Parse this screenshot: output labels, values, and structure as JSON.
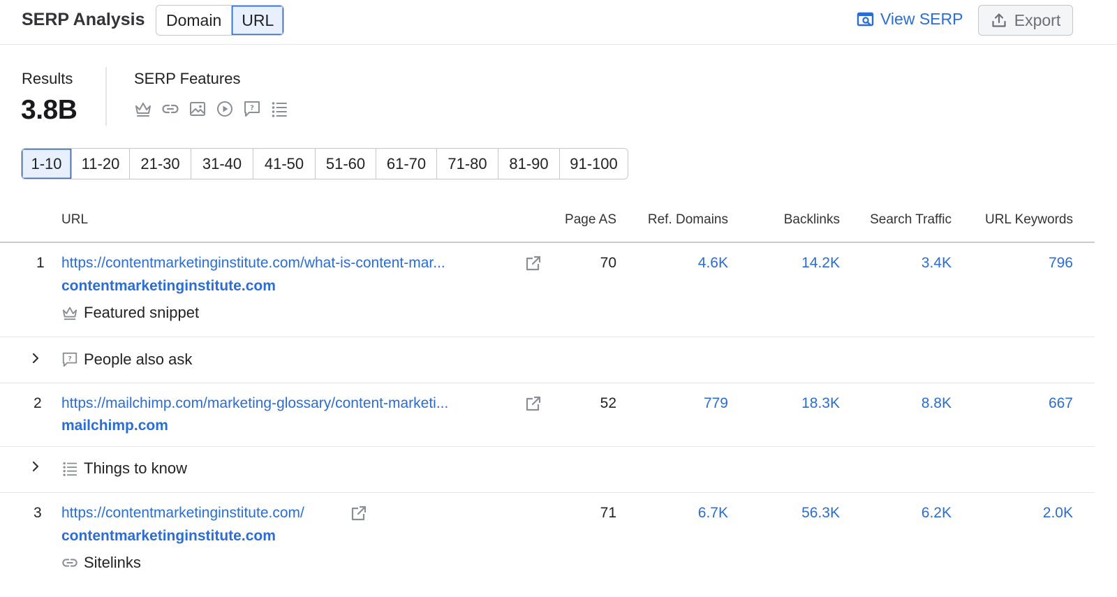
{
  "header": {
    "title": "SERP Analysis",
    "modes": [
      "Domain",
      "URL"
    ],
    "active_mode": "URL",
    "view_serp": "View SERP",
    "export": "Export"
  },
  "summary": {
    "results_label": "Results",
    "results_value": "3.8B",
    "features_label": "SERP Features",
    "feature_icons": [
      "crown-icon",
      "link-icon",
      "image-icon",
      "play-icon",
      "question-bubble-icon",
      "list-icon"
    ]
  },
  "pager": {
    "pages": [
      "1-10",
      "11-20",
      "21-30",
      "31-40",
      "41-50",
      "51-60",
      "61-70",
      "71-80",
      "81-90",
      "91-100"
    ],
    "active": "1-10"
  },
  "table": {
    "columns": {
      "url": "URL",
      "page_as": "Page AS",
      "ref_domains": "Ref. Domains",
      "backlinks": "Backlinks",
      "search_traffic": "Search Traffic",
      "url_keywords": "URL Keywords"
    },
    "rows": [
      {
        "num": "1",
        "url": "https://contentmarketinginstitute.com/what-is-content-mar...",
        "domain": "contentmarketinginstitute.com",
        "feature": "Featured snippet",
        "feature_icon": "crown-icon",
        "page_as": "70",
        "ref_domains": "4.6K",
        "backlinks": "14.2K",
        "search_traffic": "3.4K",
        "url_keywords": "796"
      },
      {
        "expandable": "People also ask",
        "icon": "question-bubble-icon"
      },
      {
        "num": "2",
        "url": "https://mailchimp.com/marketing-glossary/content-marketi...",
        "domain": "mailchimp.com",
        "page_as": "52",
        "ref_domains": "779",
        "backlinks": "18.3K",
        "search_traffic": "8.8K",
        "url_keywords": "667"
      },
      {
        "expandable": "Things to know",
        "icon": "list-icon"
      },
      {
        "num": "3",
        "url": "https://contentmarketinginstitute.com/",
        "domain": "contentmarketinginstitute.com",
        "feature": "Sitelinks",
        "feature_icon": "link-icon",
        "page_as": "71",
        "ref_domains": "6.7K",
        "backlinks": "56.3K",
        "search_traffic": "6.2K",
        "url_keywords": "2.0K"
      }
    ]
  },
  "colors": {
    "link": "#2a6dd6",
    "active_bg": "#e8f0fd",
    "border": "#c3c7cd",
    "divider": "#e3e5e8",
    "icon_gray": "#8a8e95"
  }
}
